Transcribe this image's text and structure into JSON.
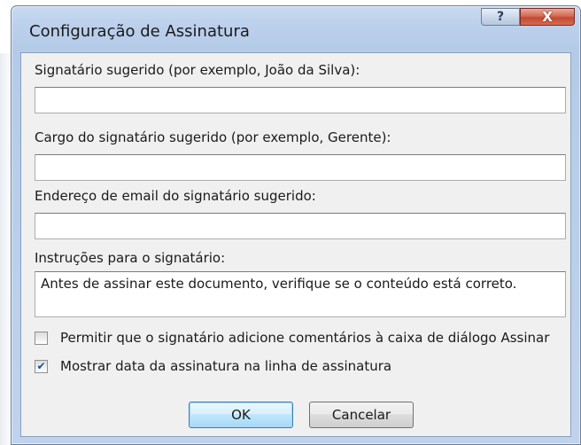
{
  "window": {
    "title": "Configuração de Assinatura",
    "help_glyph": "?",
    "close_glyph": "X"
  },
  "fields": [
    {
      "label": "Signatário sugerido (por exemplo, João da Silva):",
      "value": ""
    },
    {
      "label": "Cargo do signatário sugerido (por exemplo, Gerente):",
      "value": ""
    },
    {
      "label": "Endereço de email do signatário sugerido:",
      "value": ""
    },
    {
      "label": "Instruções para o signatário:",
      "value": "Antes de assinar este documento, verifique se o conteúdo está correto."
    }
  ],
  "checkboxes": [
    {
      "label": "Permitir que o signatário adicione comentários à caixa de diálogo Assinar",
      "checked": false
    },
    {
      "label": "Mostrar data da assinatura na linha de assinatura",
      "checked": true
    }
  ],
  "buttons": {
    "ok": "OK",
    "cancel": "Cancelar"
  }
}
